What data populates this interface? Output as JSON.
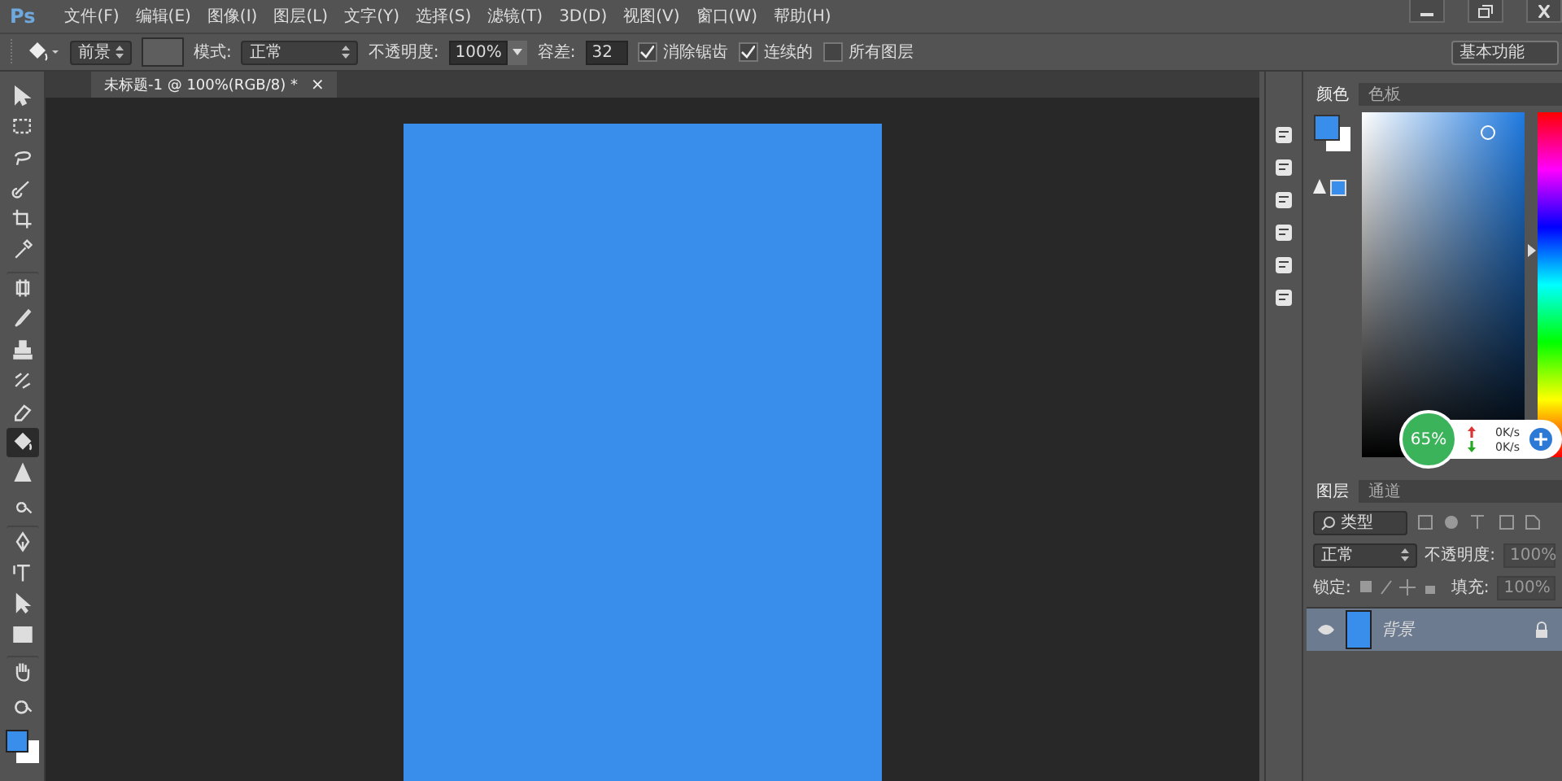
{
  "menubar": {
    "logo": "Ps",
    "menus": [
      "文件(F)",
      "编辑(E)",
      "图像(I)",
      "图层(L)",
      "文字(Y)",
      "选择(S)",
      "滤镜(T)",
      "3D(D)",
      "视图(V)",
      "窗口(W)",
      "帮助(H)"
    ]
  },
  "options_bar": {
    "fill_source": "前景",
    "mode_label": "模式:",
    "mode": "正常",
    "opacity_label": "不透明度:",
    "opacity": "100%",
    "tolerance_label": "容差:",
    "tolerance": "32",
    "checkboxes": [
      {
        "label": "消除锯齿",
        "checked": true
      },
      {
        "label": "连续的",
        "checked": true
      },
      {
        "label": "所有图层",
        "checked": false
      }
    ],
    "workspace": "基本功能"
  },
  "document_tab": {
    "title": "未标题-1 @ 100%(RGB/8) *",
    "close": "×"
  },
  "tools": [
    {
      "selected": false
    },
    {
      "selected": false
    },
    {
      "selected": false
    },
    {
      "selected": false
    },
    {
      "selected": false
    },
    {
      "selected": false
    },
    {
      "selected": false
    },
    {
      "selected": false
    },
    {
      "selected": false
    },
    {
      "selected": false
    },
    {
      "selected": false
    },
    {
      "selected": true
    },
    {
      "selected": false
    },
    {
      "selected": false
    },
    {
      "selected": false
    },
    {
      "selected": false
    },
    {
      "selected": false
    },
    {
      "selected": false
    },
    {
      "selected": false
    },
    {
      "selected": false
    }
  ],
  "color_panel": {
    "tabs": [
      {
        "label": "颜色",
        "selected": true
      },
      {
        "label": "色板",
        "selected": false
      }
    ],
    "hue_slider": {
      "level": 0.6
    }
  },
  "layers_panel": {
    "tabs": [
      {
        "label": "图层",
        "selected": true
      },
      {
        "label": "通道",
        "selected": false
      }
    ],
    "filter": "类型",
    "blend_mode": "正常",
    "opacity_label": "不透明度:",
    "opacity": "100%",
    "lock_label": "锁定:",
    "fill_label": "填充:",
    "fill": "100%",
    "layers": [
      {
        "name": "背景",
        "visible": true,
        "selected": true,
        "locked": true
      }
    ]
  },
  "speed_widget": {
    "percent": "65%",
    "upload": "0K/s",
    "download": "0K/s"
  }
}
